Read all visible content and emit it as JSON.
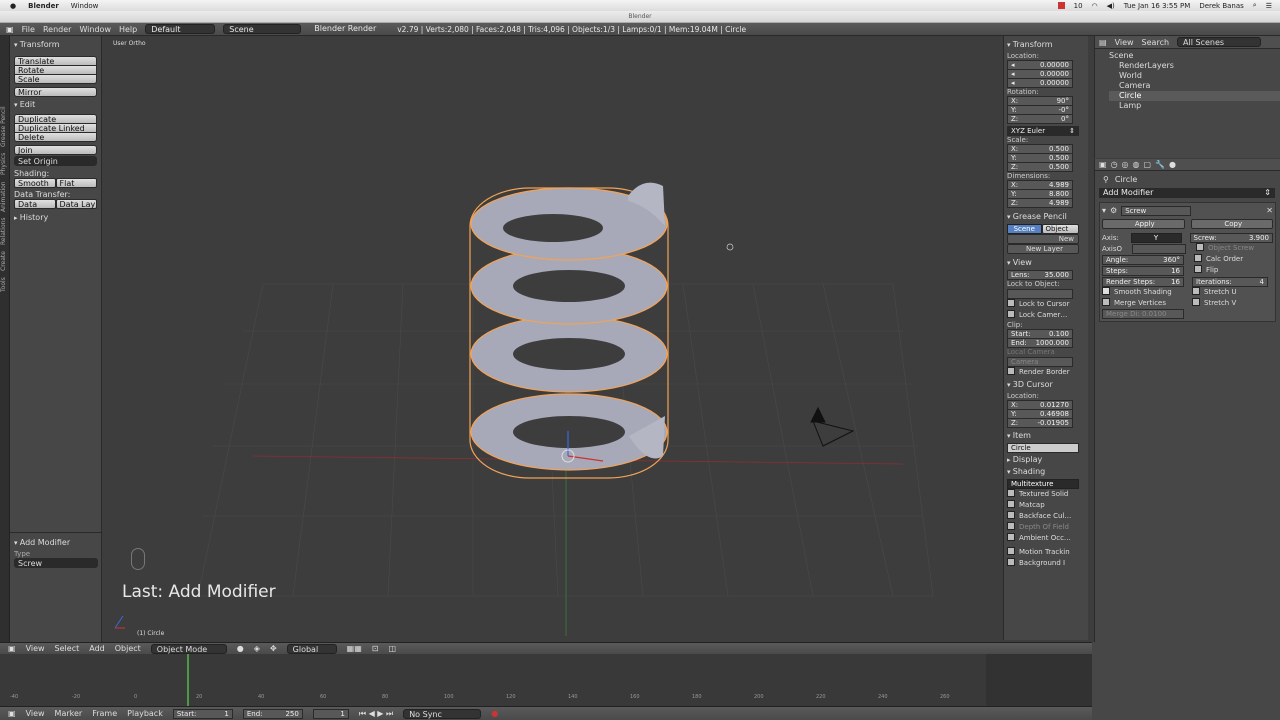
{
  "macbar": {
    "app": "Blender",
    "window": "Window",
    "datetime": "Tue Jan 16  3:55 PM",
    "user": "Derek Banas",
    "badge": "10"
  },
  "titlebar": "Blender",
  "infobar": {
    "menus": [
      "File",
      "Render",
      "Window",
      "Help"
    ],
    "layout": "Default",
    "scene": "Scene",
    "engine": "Blender Render",
    "stats": "v2.79 | Verts:2,080 | Faces:2,048 | Tris:4,096 | Objects:1/3 | Lamps:0/1 | Mem:19.04M | Circle"
  },
  "tools": {
    "transform": "Transform",
    "translate": "Translate",
    "rotate": "Rotate",
    "scale": "Scale",
    "mirror": "Mirror",
    "edit": "Edit",
    "duplicate": "Duplicate",
    "duplicate_linked": "Duplicate Linked",
    "delete": "Delete",
    "join": "Join",
    "set_origin": "Set Origin",
    "shading": "Shading:",
    "smooth": "Smooth",
    "flat": "Flat",
    "data_transfer": "Data Transfer:",
    "data": "Data",
    "data_lay": "Data Lay",
    "history": "History",
    "add_modifier": "Add Modifier",
    "type_label": "Type",
    "type_value": "Screw"
  },
  "tabs": [
    "Tools",
    "Create",
    "Relations",
    "Animation",
    "Physics",
    "Grease Pencil"
  ],
  "viewport": {
    "view_label": "User Ortho",
    "last_op": "Last: Add Modifier",
    "object_label": "(1) Circle"
  },
  "npanel": {
    "transform": "Transform",
    "location": "Location:",
    "loc": [
      "0.00000",
      "0.00000",
      "0.00000"
    ],
    "rotation": "Rotation:",
    "rot": [
      "90°",
      "-0°",
      "0°"
    ],
    "rot_mode": "XYZ Euler",
    "scale": "Scale:",
    "scl": [
      "0.500",
      "0.500",
      "0.500"
    ],
    "dimensions": "Dimensions:",
    "dim": [
      "4.989",
      "8.800",
      "4.989"
    ],
    "axes": [
      "X:",
      "Y:",
      "Z:"
    ],
    "grease": "Grease Pencil",
    "gp_scene": "Scene",
    "gp_object": "Object",
    "gp_new": "New",
    "gp_new_layer": "New Layer",
    "view": "View",
    "lens": "Lens:",
    "lens_val": "35.000",
    "lock_obj": "Lock to Object:",
    "lock_cursor": "Lock to Cursor",
    "lock_camera": "Lock Camer…",
    "clip": "Clip:",
    "clip_start": "Start:",
    "clip_start_val": "0.100",
    "clip_end": "End:",
    "clip_end_val": "1000.000",
    "local_camera": "Local Camera",
    "camera": "Camera",
    "render_border": "Render Border",
    "cursor": "3D Cursor",
    "cursor_loc": "Location:",
    "cur": [
      "0.01270",
      "0.46908",
      "-0.01905"
    ],
    "item": "Item",
    "item_name": "Circle",
    "display": "Display",
    "shading": "Shading",
    "multitexture": "Multitexture",
    "textured_solid": "Textured Solid",
    "matcap": "Matcap",
    "backface": "Backface Cul…",
    "dof": "Depth Of Field",
    "ao": "Ambient Occ…",
    "motion": "Motion Trackin",
    "background": "Background I"
  },
  "outliner": {
    "menus": [
      "View",
      "Search"
    ],
    "filter": "All Scenes",
    "items": [
      "Scene",
      "RenderLayers",
      "World",
      "Camera",
      "Circle",
      "Lamp"
    ]
  },
  "props": {
    "object": "Circle",
    "add_modifier": "Add Modifier",
    "mod_name": "Screw",
    "apply": "Apply",
    "copy": "Copy",
    "axis": "Axis:",
    "axis_val": "Y",
    "screw": "Screw:",
    "screw_val": "3.900",
    "axiso": "AxisO",
    "object_screw": "Object Screw",
    "angle": "Angle:",
    "angle_val": "360°",
    "calc_order": "Calc Order",
    "steps": "Steps:",
    "steps_val": "16",
    "flip": "Flip",
    "render_steps": "Render Steps:",
    "render_steps_val": "16",
    "iterations": "Iterations:",
    "iterations_val": "4",
    "smooth_shading": "Smooth Shading",
    "stretch_u": "Stretch U",
    "merge_vertices": "Merge Vertices",
    "stretch_v": "Stretch V",
    "merge_di": "Merge Di: 0.0100"
  },
  "timelinebar": {
    "menus": [
      "View",
      "Select",
      "Add",
      "Object"
    ],
    "mode": "Object Mode",
    "orientation": "Global"
  },
  "tlbottom": {
    "menus": [
      "View",
      "Marker",
      "Frame",
      "Playback"
    ],
    "start": "Start:",
    "start_val": "1",
    "end": "End:",
    "end_val": "250",
    "current": "1",
    "sync": "No Sync"
  },
  "timeline_ticks": [
    "-40",
    "-20",
    "0",
    "20",
    "40",
    "60",
    "80",
    "100",
    "120",
    "140",
    "160",
    "180",
    "200",
    "220",
    "240",
    "260"
  ],
  "colors": {
    "accent": "#5680c2",
    "selection": "#f5a623",
    "background": "#3d3d3d"
  }
}
